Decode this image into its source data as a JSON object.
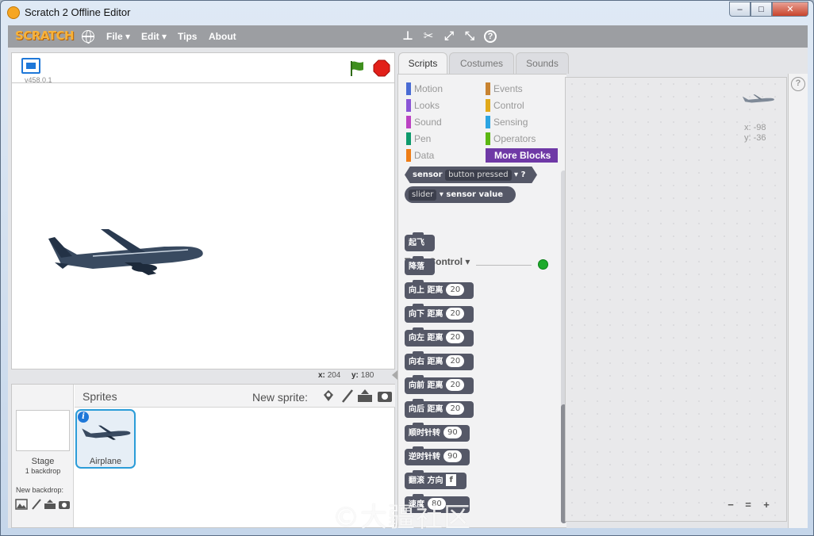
{
  "window": {
    "title": "Scratch 2 Offline Editor",
    "controls": [
      "–",
      "□",
      "✕"
    ]
  },
  "menubar": {
    "logo": "SCRATCH",
    "items": [
      {
        "label": "File ▾"
      },
      {
        "label": "Edit ▾"
      },
      {
        "label": "Tips"
      },
      {
        "label": "About"
      }
    ],
    "tools": [
      "duplicate-icon",
      "cut-icon",
      "grow-icon",
      "shrink-icon",
      "help-icon"
    ],
    "tool_glyphs": [
      "⊥",
      "✂",
      "⤢",
      "⤡",
      "?"
    ]
  },
  "stage": {
    "version": "v458.0.1",
    "coords": {
      "x_label": "x:",
      "x_value": "204",
      "y_label": "y:",
      "y_value": "180"
    }
  },
  "sprites_pane": {
    "title": "Sprites",
    "new_sprite_label": "New sprite:",
    "stage_label": "Stage",
    "backdrop_count": "1 backdrop",
    "new_backdrop_label": "New backdrop:",
    "sprites": [
      {
        "name": "Airplane",
        "info": "i"
      }
    ]
  },
  "tabs": [
    {
      "label": "Scripts",
      "active": true
    },
    {
      "label": "Costumes",
      "active": false
    },
    {
      "label": "Sounds",
      "active": false
    }
  ],
  "categories": [
    {
      "label": "Motion",
      "color": "#4a6cd4"
    },
    {
      "label": "Events",
      "color": "#c88330"
    },
    {
      "label": "Looks",
      "color": "#8a55d7"
    },
    {
      "label": "Control",
      "color": "#e1a91a"
    },
    {
      "label": "Sound",
      "color": "#bb42c3"
    },
    {
      "label": "Sensing",
      "color": "#2ca5e2"
    },
    {
      "label": "Pen",
      "color": "#0e9a6c"
    },
    {
      "label": "Operators",
      "color": "#5cb712"
    },
    {
      "label": "Data",
      "color": "#ee7d16"
    },
    {
      "label": "More Blocks",
      "color": "#632d99",
      "selected": true
    }
  ],
  "blocks": {
    "sensor_hat": {
      "label": "sensor",
      "dropdown": "button pressed",
      "suffix": "?"
    },
    "slider_reporter": {
      "dropdown": "slider",
      "label": "sensor value"
    },
    "extension_title": "Tello Control ▾",
    "commands": [
      {
        "label": "起飞"
      },
      {
        "label": "降落"
      },
      {
        "label": "向上 距离",
        "value": "20"
      },
      {
        "label": "向下 距离",
        "value": "20"
      },
      {
        "label": "向左 距离",
        "value": "20"
      },
      {
        "label": "向右 距离",
        "value": "20"
      },
      {
        "label": "向前 距离",
        "value": "20"
      },
      {
        "label": "向后 距离",
        "value": "20"
      },
      {
        "label": "顺时针转",
        "value": "90"
      },
      {
        "label": "逆时针转",
        "value": "90"
      },
      {
        "label": "翻滚 方向",
        "value": "f",
        "square": true
      },
      {
        "label": "速度",
        "value": "80"
      }
    ]
  },
  "scripts_area": {
    "x_label": "x:",
    "x_value": "-98",
    "y_label": "y:",
    "y_value": "-36",
    "zoom": [
      "−",
      "=",
      "+"
    ]
  },
  "watermark": "©大疆社区"
}
